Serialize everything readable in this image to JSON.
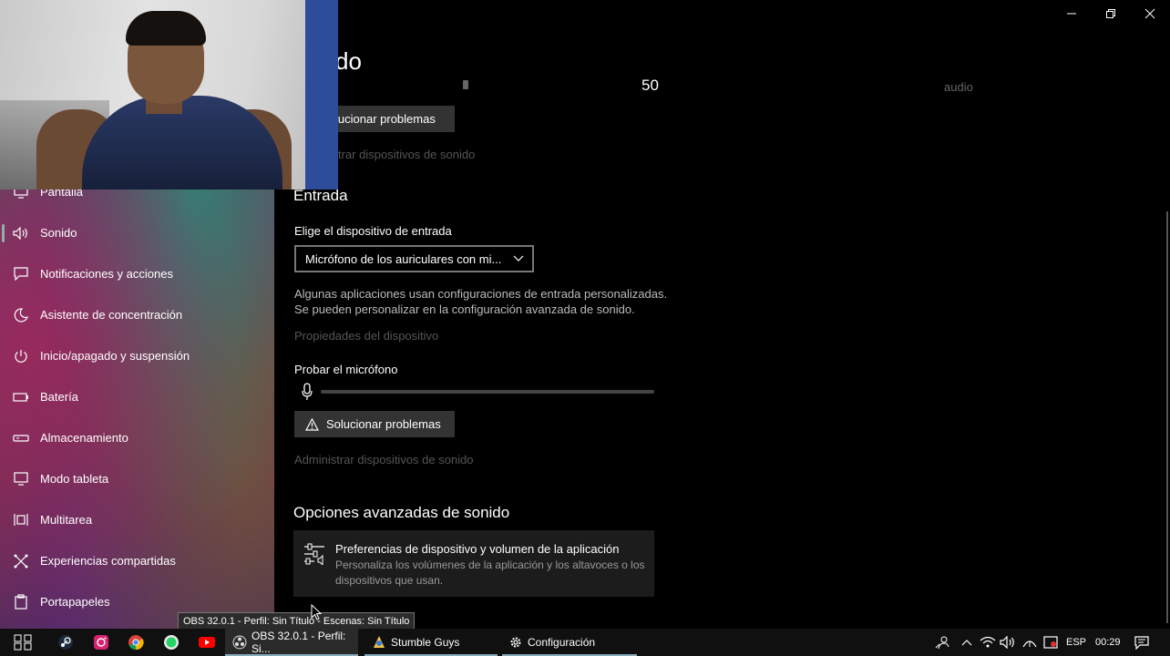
{
  "window": {
    "title_partial": "do",
    "minimize_icon": "minimize-icon",
    "restore_icon": "restore-icon",
    "close_icon": "close-icon"
  },
  "output_section": {
    "volume_value": "50",
    "audio_label": "audio",
    "troubleshoot_label": "lucionar problemas",
    "manage_devices_label": "trar dispositivos de sonido"
  },
  "sidebar": {
    "items": [
      {
        "label": "Pantalla",
        "icon": "monitor-icon"
      },
      {
        "label": "Sonido",
        "icon": "speaker-icon"
      },
      {
        "label": "Notificaciones y acciones",
        "icon": "notification-icon"
      },
      {
        "label": "Asistente de concentración",
        "icon": "moon-icon"
      },
      {
        "label": "Inicio/apagado y suspensión",
        "icon": "power-icon"
      },
      {
        "label": "Batería",
        "icon": "battery-icon"
      },
      {
        "label": "Almacenamiento",
        "icon": "storage-icon"
      },
      {
        "label": "Modo tableta",
        "icon": "tablet-icon"
      },
      {
        "label": "Multitarea",
        "icon": "multitask-icon"
      },
      {
        "label": "Experiencias compartidas",
        "icon": "shared-icon"
      },
      {
        "label": "Portapapeles",
        "icon": "clipboard-icon"
      }
    ]
  },
  "input_section": {
    "title": "Entrada",
    "device_label": "Elige el dispositivo de entrada",
    "device_selected": "Micrófono de los auriculares con mi...",
    "info_line1": "Algunas aplicaciones usan configuraciones de entrada personalizadas.",
    "info_line2": "Se pueden personalizar en la configuración avanzada de sonido.",
    "device_properties": "Propiedades del dispositivo",
    "test_mic_label": "Probar el micrófono",
    "mic_level": 0,
    "troubleshoot_label": "Solucionar problemas",
    "manage_devices_label": "Administrar dispositivos de sonido"
  },
  "advanced_section": {
    "title": "Opciones avanzadas de sonido",
    "card_title": "Preferencias de dispositivo y volumen de la aplicación",
    "card_desc": "Personaliza los volúmenes de la aplicación y los altavoces o los dispositivos que usan."
  },
  "tooltip": "OBS 32.0.1 - Perfil: Sin Título - Escenas: Sin Título",
  "taskbar": {
    "apps": [
      {
        "label": "OBS 32.0.1 - Perfil: Si...",
        "icon": "obs-icon"
      },
      {
        "label": "Stumble Guys",
        "icon": "stumble-guys-icon"
      },
      {
        "label": "Configuración",
        "icon": "settings-gear-icon"
      }
    ],
    "language": "ESP",
    "time": "00:29"
  },
  "colors": {
    "accent": "#88aabb",
    "background": "#000000",
    "button": "#333333"
  }
}
